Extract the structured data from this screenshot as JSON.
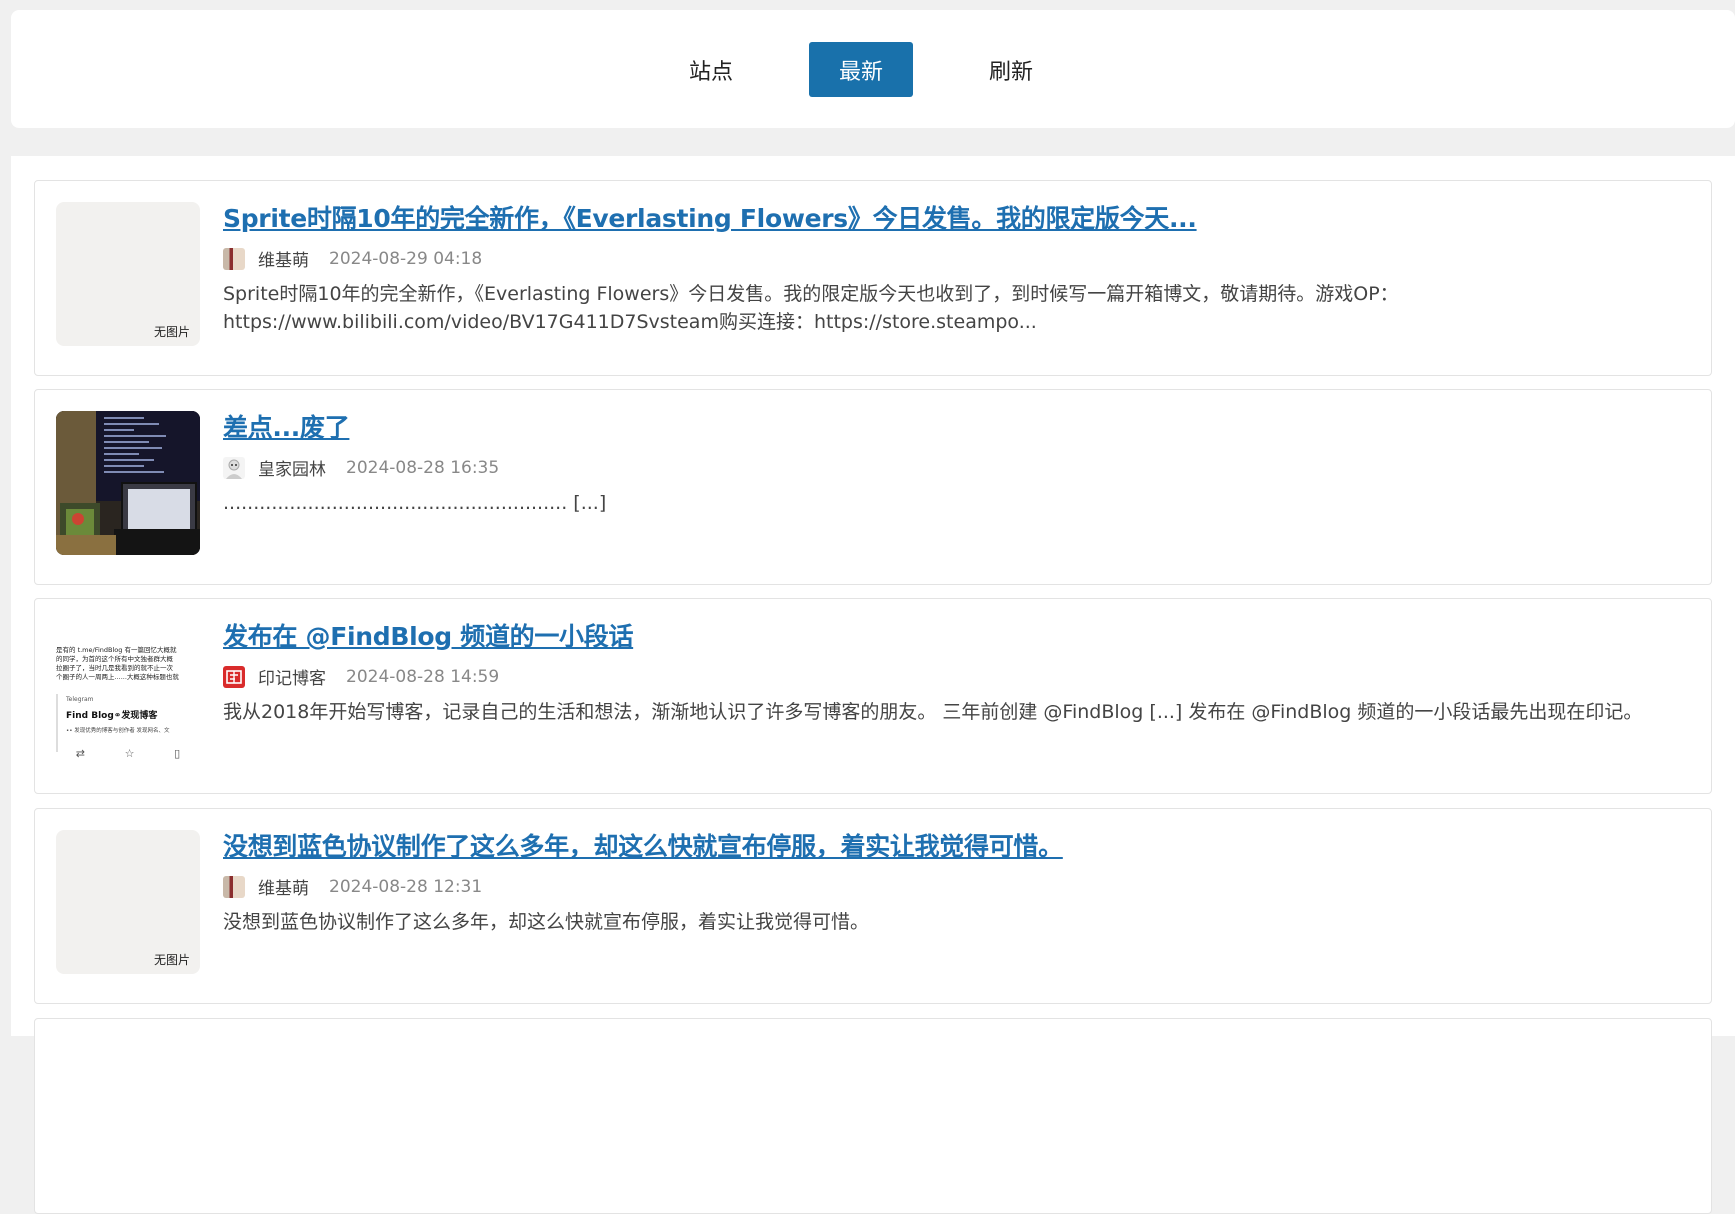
{
  "tabs": {
    "sites_label": "站点",
    "latest_label": "最新",
    "refresh_label": "刷新"
  },
  "posts": [
    {
      "title": "Sprite时隔10年的完全新作，《Everlasting Flowers》今日发售。我的限定版今天...",
      "author": "维基萌",
      "date": "2024-08-29 04:18",
      "excerpt": "Sprite时隔10年的完全新作，《Everlasting Flowers》今日发售。我的限定版今天也收到了，到时候写一篇开箱博文，敬请期待。游戏OP：https://www.bilibili.com/video/BV17G411D7Svsteam购买连接：https://store.steampo...",
      "thumb_label": "无图片"
    },
    {
      "title": "差点...废了",
      "author": "皇家园林",
      "date": "2024-08-28 16:35",
      "excerpt": "......................................................... [...]",
      "thumb_label": ""
    },
    {
      "title": "发布在 @FindBlog 频道的一小段话",
      "author": "印记博客",
      "date": "2024-08-28 14:59",
      "excerpt": "我从2018年开始写博客，记录自己的生活和想法，渐渐地认识了许多写博客的朋友。 三年前创建 @FindBlog [...] 发布在 @FindBlog 频道的一小段话最先出现在印记。",
      "thumb_label": ""
    },
    {
      "title": "没想到蓝色协议制作了这么多年，却这么快就宣布停服，着实让我觉得可惜。",
      "author": "维基萌",
      "date": "2024-08-28 12:31",
      "excerpt": "没想到蓝色协议制作了这么多年，却这么快就宣布停服，着实让我觉得可惜。",
      "thumb_label": "无图片"
    }
  ],
  "thumb3_text": {
    "line1": "是有的 t.me/FindBlog 有一篇回忆大概就",
    "line2": "的同学，为首的这个所有中文独者群大概",
    "line3": "拉圈子了，当时几是我看到的就不止一次",
    "line4": "个圈子的人一周两上......大概这种标题也就",
    "telegram": "Telegram",
    "card_title": "Find Blog⚭发现博客",
    "card_sub": "•• 发现优秀的博客与创作者 发现网名、文"
  },
  "colors": {
    "accent": "#1971ab",
    "link": "#1e6fb0"
  }
}
